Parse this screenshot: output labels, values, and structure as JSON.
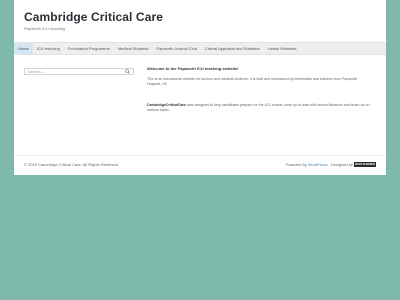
{
  "header": {
    "title": "Cambridge Critical Care",
    "description": "Papworth ICU teaching"
  },
  "nav": {
    "items": [
      "Home",
      "ICU teaching",
      "Foundation Programme",
      "Medical Students",
      "Papworth Journal Club",
      "Critical Appraisal and Statistics",
      "Useful Websites"
    ]
  },
  "sidebar": {
    "search_placeholder": "Search..."
  },
  "main": {
    "welcome": "Welcome to the Papworth ICU teaching website!",
    "paragraph1": "This is an educational website for doctors and medical students. It is built and maintained by intensivists and trainees from Papworth Hospital, UK.",
    "paragraph2_strong": "CambridgeCriticalCare",
    "paragraph2_rest": " was designed to help candidates prepare for the ICU exams, keep up to date with recent literature and brush up on various topics."
  },
  "footer": {
    "copyright": "© 2016 Cambridge Critical Care. All Rights Reserved.",
    "powered_prefix": "Powered by ",
    "powered_link": "WordPress",
    "designed_by": ". Designed by ",
    "designer_logo_text": "WOOTHEMES"
  }
}
